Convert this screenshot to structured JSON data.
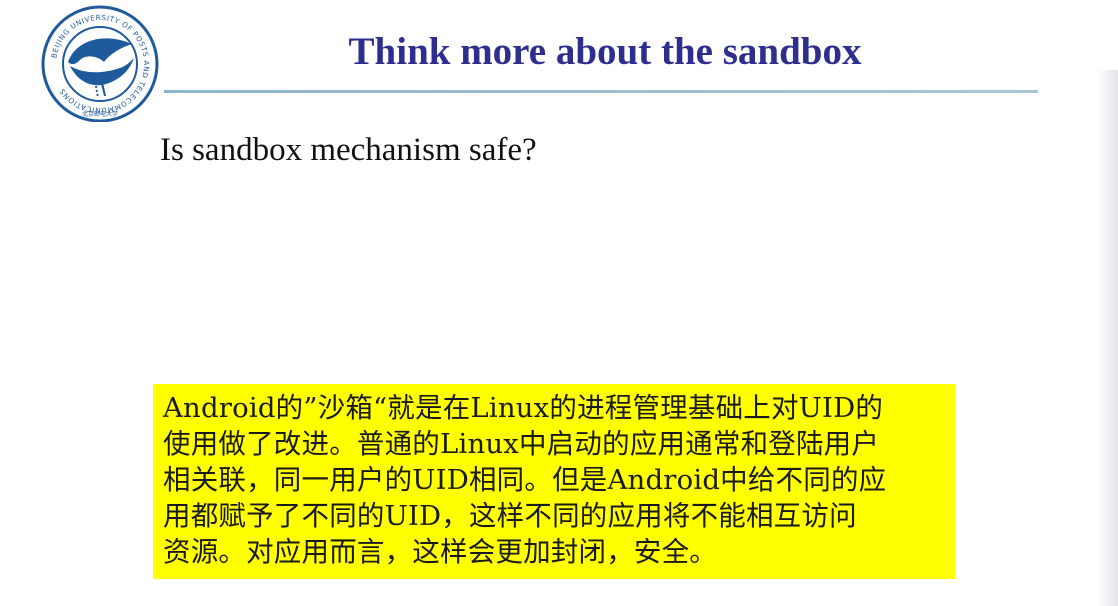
{
  "slide": {
    "title": "Think more about the sandbox",
    "question": "Is sandbox mechanism safe?",
    "note_lines": [
      "Android的”沙箱“就是在Linux的进程管理基础上对UID的",
      "使用做了改进。普通的Linux中启动的应用通常和登陆用户",
      "相关联，同一用户的UID相同。但是Android中给不同的应",
      "用都赋予了不同的UID，这样不同的应用将不能相互访问",
      "资源。对应用而言，这样会更加封闭，安全。"
    ]
  },
  "logo": {
    "ring_text": "BEIJING UNIVERSITY OF POSTS AND TELECOMMUNICATIONS",
    "inner_text": "北京邮电大学"
  },
  "colors": {
    "title": "#2e2e8f",
    "rule": "#9dbdd2",
    "highlight": "#ffff00",
    "logo_blue": "#1f5a9c"
  }
}
